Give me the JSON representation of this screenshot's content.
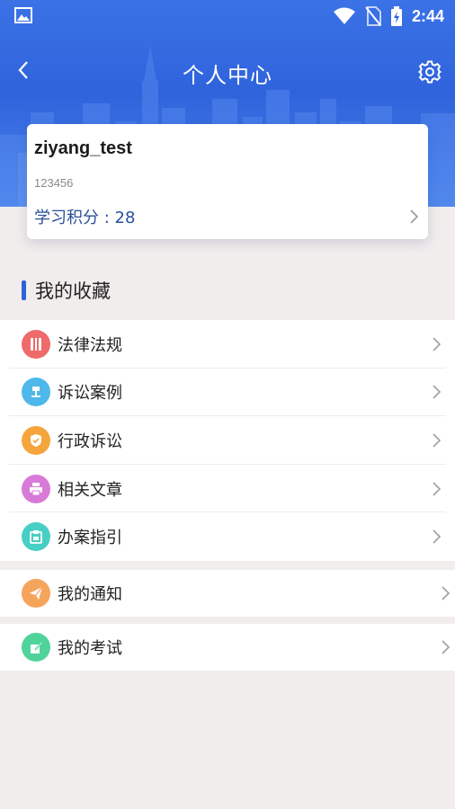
{
  "status_bar": {
    "time": "2:44",
    "icons": [
      "image-icon",
      "wifi-icon",
      "no-sim-icon",
      "battery-charging-icon"
    ]
  },
  "navbar": {
    "title": "个人中心",
    "back_icon": "chevron-left-icon",
    "settings_icon": "gear-icon"
  },
  "profile": {
    "username": "ziyang_test",
    "user_id": "123456",
    "points_text": "学习积分 : 28"
  },
  "favorites": {
    "title": "我的收藏",
    "items": [
      {
        "label": "法律法规",
        "icon": "book-icon",
        "color": "#ef6a6a"
      },
      {
        "label": "诉讼案例",
        "icon": "gavel-icon",
        "color": "#4fb8ea"
      },
      {
        "label": "行政诉讼",
        "icon": "shield-icon",
        "color": "#f6a53c"
      },
      {
        "label": "相关文章",
        "icon": "printer-icon",
        "color": "#d77ad8"
      },
      {
        "label": "办案指引",
        "icon": "clipboard-icon",
        "color": "#47cfc3"
      }
    ]
  },
  "notifications": {
    "label": "我的通知",
    "icon": "paper-plane-icon",
    "color": "#f5a55b"
  },
  "exams": {
    "label": "我的考试",
    "icon": "edit-icon",
    "color": "#4fd39a"
  },
  "colors": {
    "header_blue": "#2f63dc",
    "accent_bar": "#2b63d9",
    "points_text": "#2a4f9a",
    "page_bg": "#f2eded"
  }
}
